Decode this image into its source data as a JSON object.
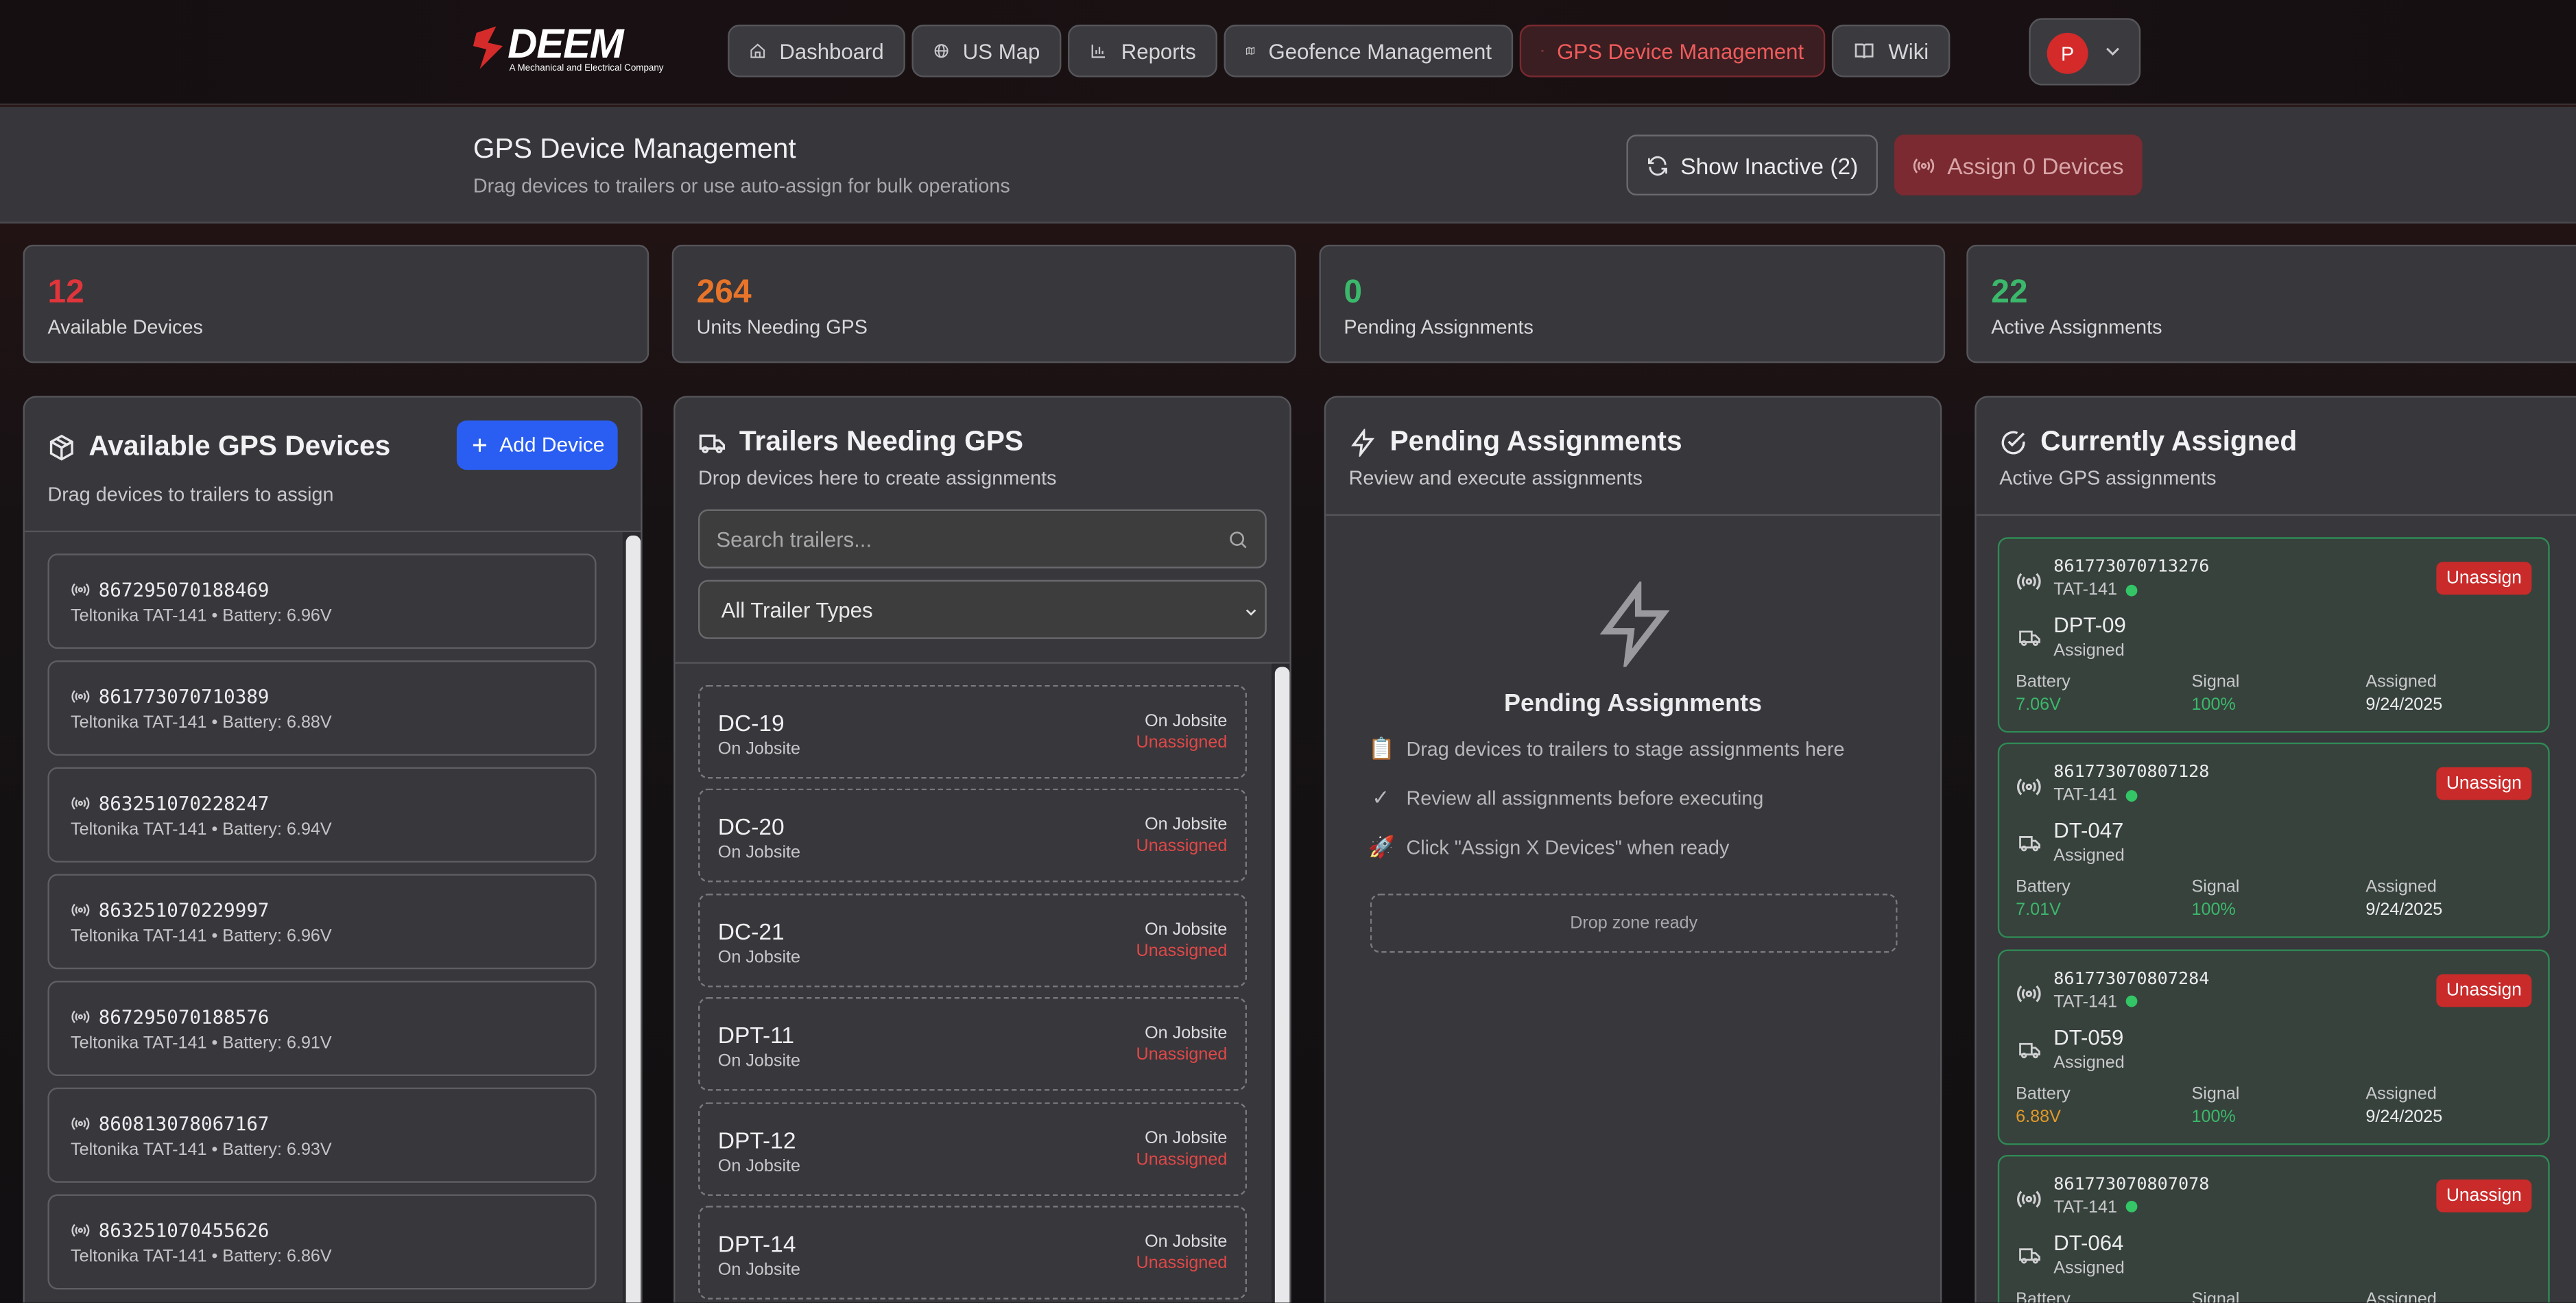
{
  "brand": {
    "name": "DEEM",
    "tagline": "A Mechanical and Electrical Company"
  },
  "nav": [
    {
      "label": "Dashboard",
      "icon": "home-icon"
    },
    {
      "label": "US Map",
      "icon": "globe-icon"
    },
    {
      "label": "Reports",
      "icon": "bar-chart-icon"
    },
    {
      "label": "Geofence Management",
      "icon": "map-icon"
    },
    {
      "label": "GPS Device Management",
      "icon": "chip-icon",
      "active": true
    },
    {
      "label": "Wiki",
      "icon": "book-icon"
    }
  ],
  "user": {
    "initial": "P"
  },
  "header": {
    "title": "GPS Device Management",
    "subtitle": "Drag devices to trailers or use auto-assign for bulk operations",
    "show_inactive": "Show Inactive (2)",
    "assign": "Assign 0 Devices"
  },
  "stats": [
    {
      "value": "12",
      "label": "Available Devices",
      "color": "#e0353b"
    },
    {
      "value": "264",
      "label": "Units Needing GPS",
      "color": "#e8742a"
    },
    {
      "value": "0",
      "label": "Pending Assignments",
      "color": "#3bb86b"
    },
    {
      "value": "22",
      "label": "Active Assignments",
      "color": "#3bb86b"
    }
  ],
  "available": {
    "title": "Available GPS Devices",
    "subtitle": "Drag devices to trailers to assign",
    "add_button": "Add Device",
    "devices": [
      {
        "id": "867295070188469",
        "meta": "Teltonika TAT-141 • Battery: 6.96V"
      },
      {
        "id": "861773070710389",
        "meta": "Teltonika TAT-141 • Battery: 6.88V"
      },
      {
        "id": "863251070228247",
        "meta": "Teltonika TAT-141 • Battery: 6.94V"
      },
      {
        "id": "863251070229997",
        "meta": "Teltonika TAT-141 • Battery: 6.96V"
      },
      {
        "id": "867295070188576",
        "meta": "Teltonika TAT-141 • Battery: 6.91V"
      },
      {
        "id": "860813078067167",
        "meta": "Teltonika TAT-141 • Battery: 6.93V"
      },
      {
        "id": "863251070455626",
        "meta": "Teltonika TAT-141 • Battery: 6.86V"
      }
    ]
  },
  "trailers": {
    "title": "Trailers Needing GPS",
    "subtitle": "Drop devices here to create assignments",
    "search_placeholder": "Search trailers...",
    "filter": "All Trailer Types",
    "items": [
      {
        "name": "DC-19",
        "status": "On Jobsite",
        "location": "On Jobsite",
        "gps": "Unassigned"
      },
      {
        "name": "DC-20",
        "status": "On Jobsite",
        "location": "On Jobsite",
        "gps": "Unassigned"
      },
      {
        "name": "DC-21",
        "status": "On Jobsite",
        "location": "On Jobsite",
        "gps": "Unassigned"
      },
      {
        "name": "DPT-11",
        "status": "On Jobsite",
        "location": "On Jobsite",
        "gps": "Unassigned"
      },
      {
        "name": "DPT-12",
        "status": "On Jobsite",
        "location": "On Jobsite",
        "gps": "Unassigned"
      },
      {
        "name": "DPT-14",
        "status": "On Jobsite",
        "location": "On Jobsite",
        "gps": "Unassigned"
      }
    ]
  },
  "pending": {
    "title": "Pending Assignments",
    "subtitle": "Review and execute assignments",
    "empty_title": "Pending Assignments",
    "hints": [
      {
        "icon": "📋",
        "text": "Drag devices to trailers to stage assignments here"
      },
      {
        "icon": "✓",
        "text": "Review all assignments before executing"
      },
      {
        "icon": "🚀",
        "text": "Click \"Assign X Devices\" when ready"
      }
    ],
    "dropzone": "Drop zone ready"
  },
  "assigned": {
    "title": "Currently Assigned",
    "subtitle": "Active GPS assignments",
    "unassign": "Unassign",
    "labels": {
      "battery": "Battery",
      "signal": "Signal",
      "assigned": "Assigned"
    },
    "items": [
      {
        "id": "861773070713276",
        "model": "TAT-141",
        "trailer": "DPT-09",
        "status": "Assigned",
        "battery": "7.06V",
        "battery_color": "#3bb86b",
        "signal": "100%",
        "date": "9/24/2025"
      },
      {
        "id": "861773070807128",
        "model": "TAT-141",
        "trailer": "DT-047",
        "status": "Assigned",
        "battery": "7.01V",
        "battery_color": "#3bb86b",
        "signal": "100%",
        "date": "9/24/2025"
      },
      {
        "id": "861773070807284",
        "model": "TAT-141",
        "trailer": "DT-059",
        "status": "Assigned",
        "battery": "6.88V",
        "battery_color": "#e39a28",
        "signal": "100%",
        "date": "9/24/2025"
      },
      {
        "id": "861773070807078",
        "model": "TAT-141",
        "trailer": "DT-064",
        "status": "Assigned",
        "battery": "",
        "battery_color": "#3bb86b",
        "signal": "",
        "date": ""
      }
    ]
  }
}
